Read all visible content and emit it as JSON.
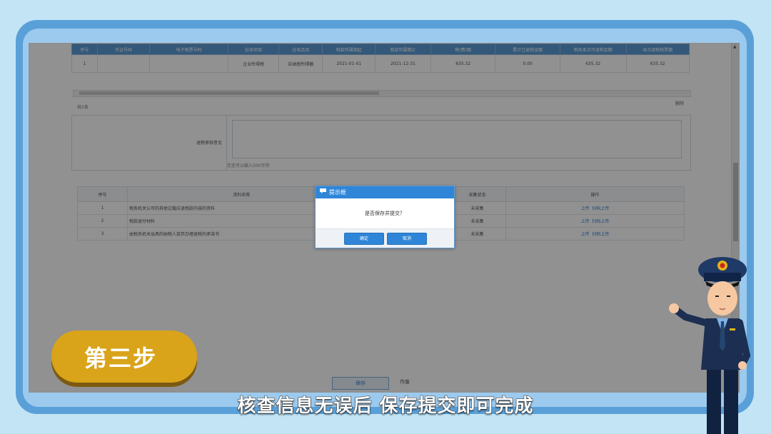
{
  "grid": {
    "headers": [
      "序号",
      "凭证号码",
      "电子税票号码",
      "征收项目",
      "征收品目",
      "税款所属期起",
      "税款所属期止",
      "税(费)额",
      "累计已退税金额",
      "税务本次可退税金额",
      "本次退税税票额"
    ],
    "rows": [
      [
        "1",
        "",
        "",
        "企业所得税",
        "应纳税所得额",
        "2021-01-01",
        "2021-12-31",
        "635.32",
        "0.00",
        "635.32",
        "635.32"
      ]
    ]
  },
  "total_text": "共1条",
  "delete_label": "删除",
  "opinion_label": "退税审核意见",
  "opinion_hint": "您还可以输入500字符",
  "materials": {
    "headers": [
      "序号",
      "资料名称",
      "",
      "采集状态",
      "操作"
    ],
    "rows": [
      {
        "no": "1",
        "name": "税务机关认可的其他记载应退税款内容的资料",
        "status": "未采集",
        "upload": "上传",
        "scan": "扫码上传"
      },
      {
        "no": "2",
        "name": "税款退付材料",
        "status": "未采集",
        "upload": "上传",
        "scan": "扫码上传"
      },
      {
        "no": "3",
        "name": "由税务机关出具的纳税人放弃办理退税的承诺书",
        "status": "未采集",
        "upload": "上传",
        "scan": "扫码上传"
      }
    ]
  },
  "buttons": {
    "save": "保存",
    "void": "作废"
  },
  "dialog": {
    "title": "提示框",
    "message": "是否保存并提交？",
    "confirm": "确定",
    "cancel": "取消"
  },
  "step_label": "第三步",
  "subtitle": "核查信息无误后 保存提交即可完成",
  "colors": {
    "accent": "#2f86d8",
    "badge": "#d9a41a",
    "frame": "#5aa0d8"
  }
}
